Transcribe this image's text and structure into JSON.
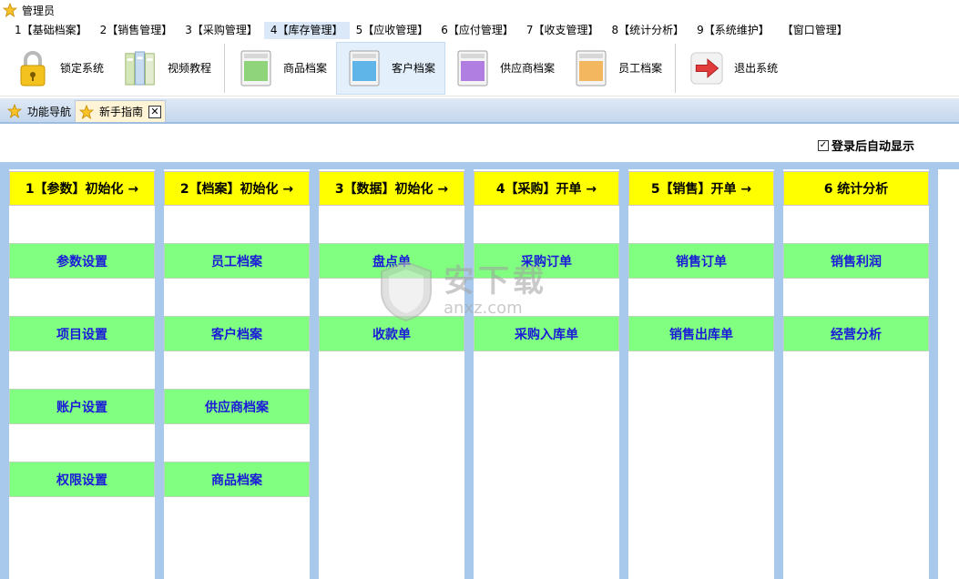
{
  "window": {
    "title": "管理员"
  },
  "menu": [
    {
      "label": "1【基础档案】",
      "active": false
    },
    {
      "label": "2【销售管理】",
      "active": false
    },
    {
      "label": "3【采购管理】",
      "active": false
    },
    {
      "label": "4【库存管理】",
      "active": true
    },
    {
      "label": "5【应收管理】",
      "active": false
    },
    {
      "label": "6【应付管理】",
      "active": false
    },
    {
      "label": "7【收支管理】",
      "active": false
    },
    {
      "label": "8【统计分析】",
      "active": false
    },
    {
      "label": "9【系统维护】",
      "active": false
    },
    {
      "label": "【窗口管理】",
      "active": false
    }
  ],
  "toolbar": {
    "lock": "锁定系统",
    "video": "视频教程",
    "goods": "商品档案",
    "customer": "客户档案",
    "supplier": "供应商档案",
    "employee": "员工档案",
    "exit": "退出系统"
  },
  "tabs": {
    "nav": "功能导航",
    "guide": "新手指南"
  },
  "options": {
    "auto_show": "登录后自动显示",
    "auto_show_checked": true
  },
  "columns": [
    {
      "head": "1【参数】初始化 →",
      "items": [
        "参数设置",
        "项目设置",
        "账户设置",
        "权限设置"
      ]
    },
    {
      "head": "2【档案】初始化 →",
      "items": [
        "员工档案",
        "客户档案",
        "供应商档案",
        "商品档案"
      ]
    },
    {
      "head": "3【数据】初始化 →",
      "items": [
        "盘点单",
        "收款单"
      ]
    },
    {
      "head": "4【采购】开单 →",
      "items": [
        "采购订单",
        "采购入库单"
      ]
    },
    {
      "head": "5【销售】开单 →",
      "items": [
        "销售订单",
        "销售出库单"
      ]
    },
    {
      "head": "6 统计分析",
      "items": [
        "销售利润",
        "经营分析"
      ]
    }
  ],
  "watermark": {
    "cn": "安下载",
    "en": "anxz.com"
  },
  "colors": {
    "head_yellow": "#ffff00",
    "item_green": "#80ff80",
    "item_text": "#1a1ad8",
    "board_blue": "#a9c9ec"
  }
}
